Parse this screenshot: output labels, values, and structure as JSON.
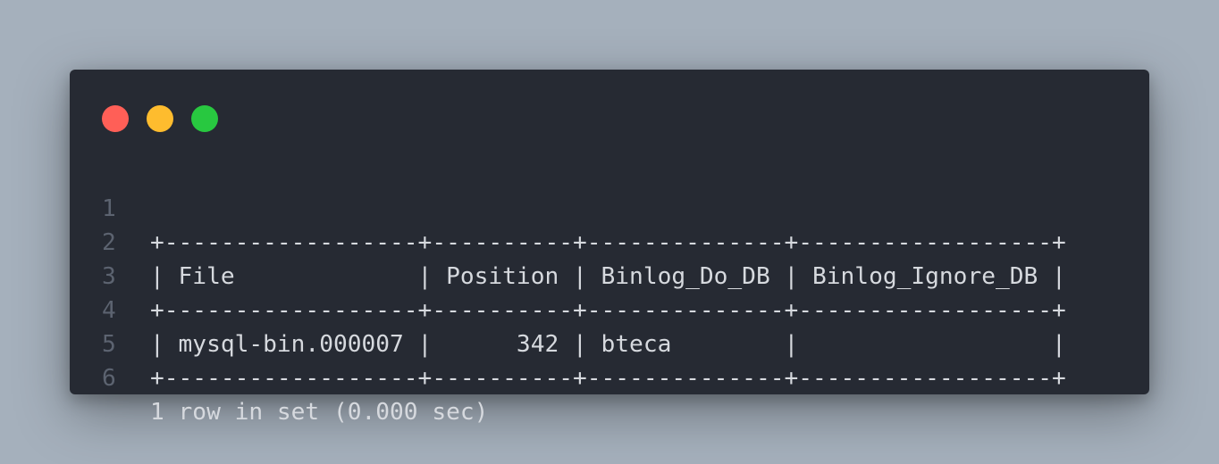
{
  "window": {
    "controls": [
      {
        "name": "close",
        "color": "#ff5f57"
      },
      {
        "name": "minimize",
        "color": "#febc2e"
      },
      {
        "name": "maximize",
        "color": "#28c840"
      }
    ]
  },
  "code": {
    "lines": [
      {
        "number": "1",
        "text": "+------------------+----------+--------------+------------------+"
      },
      {
        "number": "2",
        "text": "| File             | Position | Binlog_Do_DB | Binlog_Ignore_DB |"
      },
      {
        "number": "3",
        "text": "+------------------+----------+--------------+------------------+"
      },
      {
        "number": "4",
        "text": "| mysql-bin.000007 |      342 | bteca        |                  |"
      },
      {
        "number": "5",
        "text": "+------------------+----------+--------------+------------------+"
      },
      {
        "number": "6",
        "text": "1 row in set (0.000 sec)"
      }
    ]
  }
}
